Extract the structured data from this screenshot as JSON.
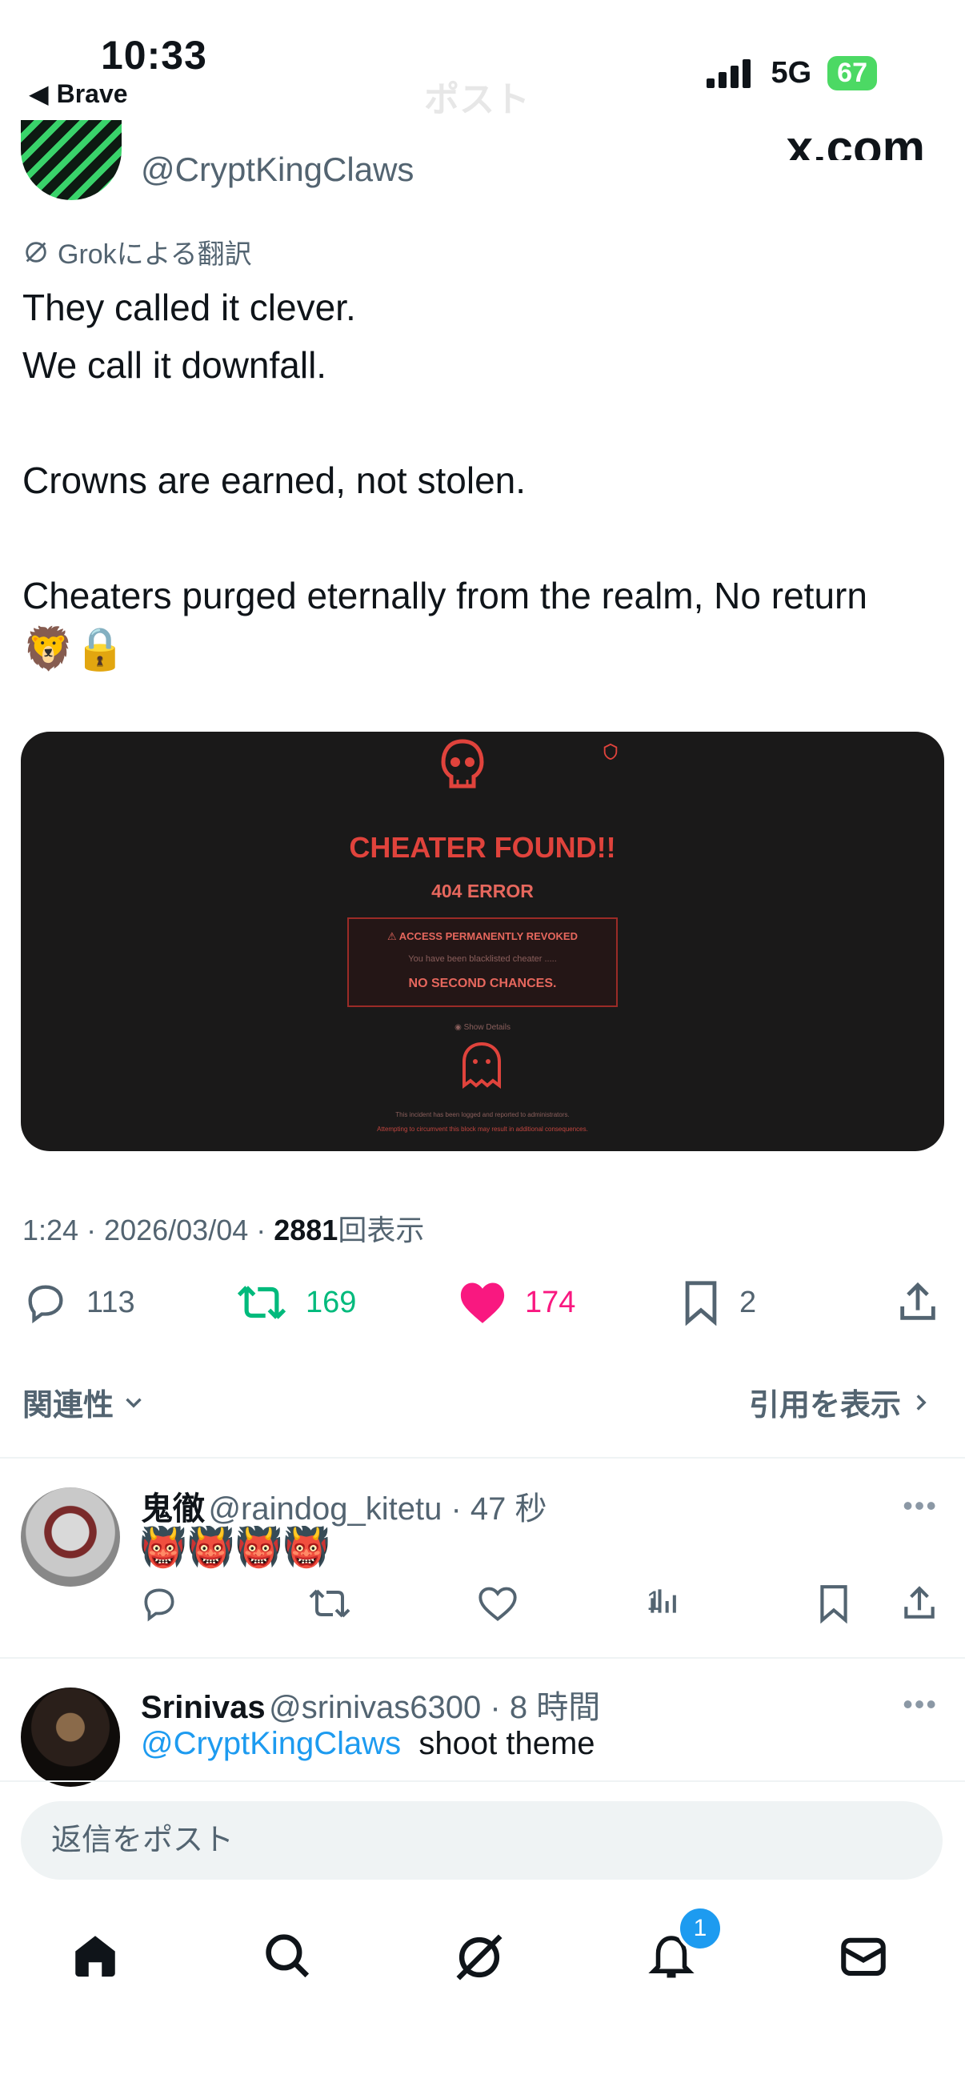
{
  "status_bar": {
    "time": "10:33",
    "back_app": "Brave",
    "network": "5G",
    "battery": "67"
  },
  "header": {
    "ghost_title": "ポスト",
    "site": "x.com"
  },
  "post": {
    "handle": "@CryptKingClaws",
    "translation_label": "Grokによる翻訳",
    "text": "They called it clever.\nWe call it downfall.\n\nCrowns are earned, not stolen.\n\nCheaters purged eternally from the realm, No return",
    "emoji": "🦁🔒",
    "image": {
      "title": "CHEATER FOUND!!",
      "error": "404 ERROR",
      "warning_title": "ACCESS PERMANENTLY REVOKED",
      "warning_sub": "You have been blacklisted cheater .....",
      "warning_main": "NO SECOND CHANCES.",
      "details_link": "Show Details",
      "footer1": "This incident has been logged and reported to administrators.",
      "footer2": "Attempting to circumvent this block may result in additional consequences."
    },
    "timestamp": "1:24 · 2026/03/04 · ",
    "views_count": "2881",
    "views_label": "回表示",
    "replies": "113",
    "reposts": "169",
    "likes": "174",
    "bookmarks": "2"
  },
  "controls": {
    "sort_label": "関連性",
    "quotes_label": "引用を表示"
  },
  "replies": [
    {
      "name": "鬼徹",
      "handle": "@raindog_kitetu · 47 秒",
      "text": "👹👹👹👹",
      "views": "1"
    },
    {
      "name": "Srinivas",
      "handle": "@srinivas6300 · 8 時間",
      "mention": "@CryptKingClaws",
      "text": "shoot theme"
    }
  ],
  "compose": {
    "placeholder": "返信をポスト"
  },
  "tabbar": {
    "notifications_badge": "1"
  },
  "colors": {
    "like": "#f91880",
    "repost": "#00ba7c",
    "link": "#1d9bf0",
    "cheater_red": "#e0433c"
  }
}
